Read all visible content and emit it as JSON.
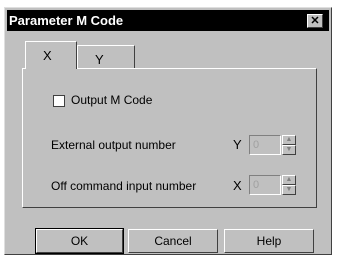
{
  "dialog": {
    "title": "Parameter M Code",
    "close_glyph": "✕"
  },
  "tabs": [
    {
      "label": "X",
      "active": true
    },
    {
      "label": "Y",
      "active": false
    }
  ],
  "output_m_code": {
    "label": "Output M Code",
    "checked": false
  },
  "external_output": {
    "label": "External output number",
    "axis": "Y",
    "value": "0"
  },
  "off_command_input": {
    "label": "Off command input number",
    "axis": "X",
    "value": "0"
  },
  "buttons": {
    "ok": "OK",
    "cancel": "Cancel",
    "help": "Help"
  },
  "icons": {
    "spin_up": "spin-up-icon",
    "spin_down": "spin-down-icon"
  },
  "colors": {
    "title_bar": "#000000",
    "dialog_bg": "#c0c0c0"
  }
}
